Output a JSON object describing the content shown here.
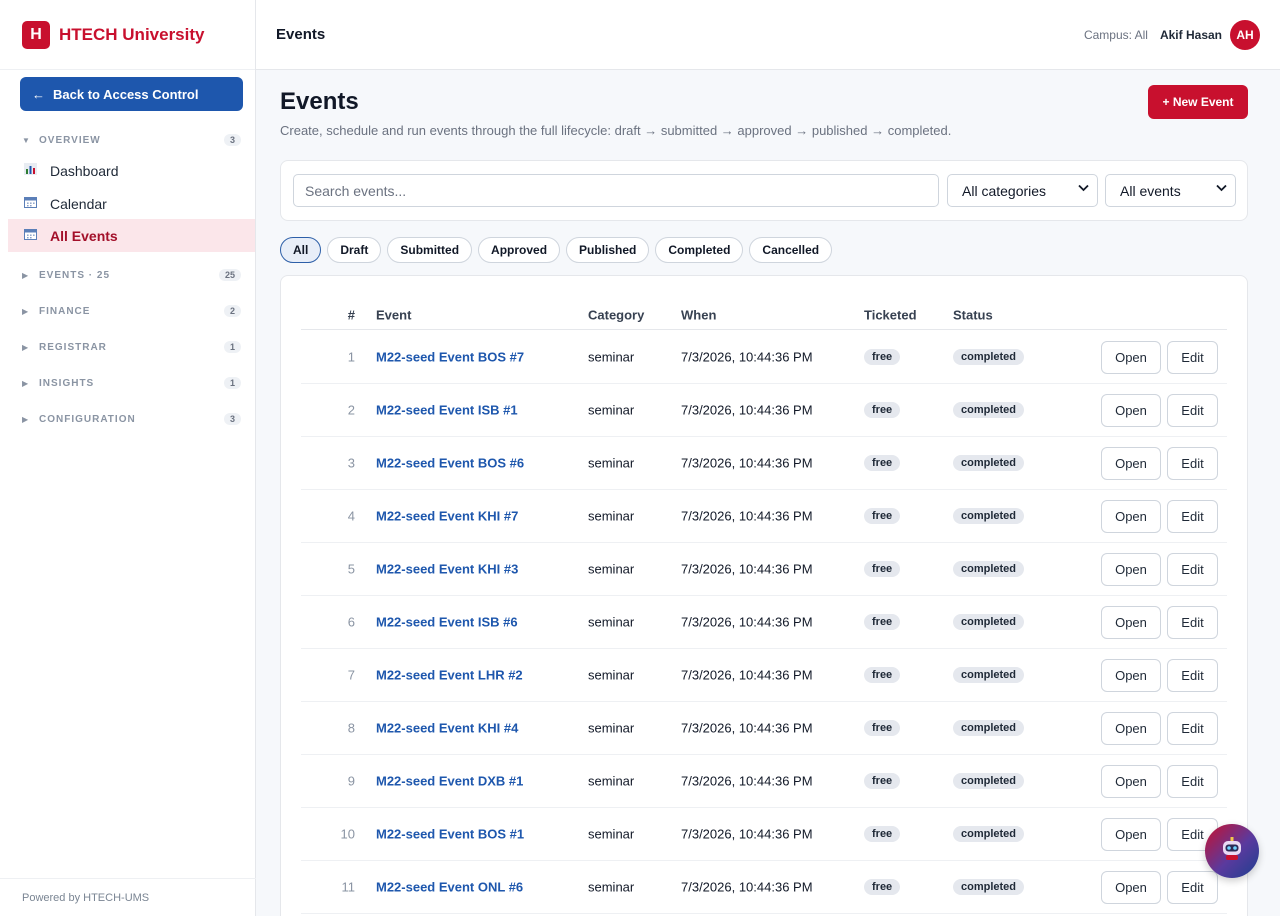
{
  "brand": {
    "logo": "H",
    "name": "HTECH University"
  },
  "sidebar": {
    "back_label": "Back to Access Control",
    "groups": [
      {
        "label": "OVERVIEW",
        "count": "3",
        "expanded": true
      },
      {
        "label": "EVENTS · 25",
        "count": "25",
        "expanded": false
      },
      {
        "label": "FINANCE",
        "count": "2",
        "expanded": false
      },
      {
        "label": "REGISTRAR",
        "count": "1",
        "expanded": false
      },
      {
        "label": "INSIGHTS",
        "count": "1",
        "expanded": false
      },
      {
        "label": "CONFIGURATION",
        "count": "3",
        "expanded": false
      }
    ],
    "items": [
      {
        "label": "Dashboard",
        "icon": "bar-chart-icon"
      },
      {
        "label": "Calendar",
        "icon": "calendar-icon"
      },
      {
        "label": "All Events",
        "icon": "calendar-icon",
        "active": true
      }
    ],
    "footer": "Powered by HTECH-UMS"
  },
  "topbar": {
    "title": "Events",
    "campus": "Campus: All",
    "user": "Akif Hasan",
    "avatar": "AH"
  },
  "page": {
    "title": "Events",
    "subtitle": "Create, schedule and run events through the full lifecycle: draft → submitted → approved → published → completed.",
    "new_button": "+ New Event"
  },
  "filters": {
    "search_placeholder": "Search events...",
    "category_value": "All categories",
    "scope_value": "All events"
  },
  "tabs": [
    "All",
    "Draft",
    "Submitted",
    "Approved",
    "Published",
    "Completed",
    "Cancelled"
  ],
  "table": {
    "headers": {
      "num": "#",
      "event": "Event",
      "category": "Category",
      "when": "When",
      "ticketed": "Ticketed",
      "status": "Status"
    },
    "open_label": "Open",
    "edit_label": "Edit",
    "rows": [
      {
        "num": "1",
        "event": "M22-seed Event BOS #7",
        "category": "seminar",
        "when": "7/3/2026, 10:44:36 PM",
        "ticketed": "free",
        "status": "completed"
      },
      {
        "num": "2",
        "event": "M22-seed Event ISB #1",
        "category": "seminar",
        "when": "7/3/2026, 10:44:36 PM",
        "ticketed": "free",
        "status": "completed"
      },
      {
        "num": "3",
        "event": "M22-seed Event BOS #6",
        "category": "seminar",
        "when": "7/3/2026, 10:44:36 PM",
        "ticketed": "free",
        "status": "completed"
      },
      {
        "num": "4",
        "event": "M22-seed Event KHI #7",
        "category": "seminar",
        "when": "7/3/2026, 10:44:36 PM",
        "ticketed": "free",
        "status": "completed"
      },
      {
        "num": "5",
        "event": "M22-seed Event KHI #3",
        "category": "seminar",
        "when": "7/3/2026, 10:44:36 PM",
        "ticketed": "free",
        "status": "completed"
      },
      {
        "num": "6",
        "event": "M22-seed Event ISB #6",
        "category": "seminar",
        "when": "7/3/2026, 10:44:36 PM",
        "ticketed": "free",
        "status": "completed"
      },
      {
        "num": "7",
        "event": "M22-seed Event LHR #2",
        "category": "seminar",
        "when": "7/3/2026, 10:44:36 PM",
        "ticketed": "free",
        "status": "completed"
      },
      {
        "num": "8",
        "event": "M22-seed Event KHI #4",
        "category": "seminar",
        "when": "7/3/2026, 10:44:36 PM",
        "ticketed": "free",
        "status": "completed"
      },
      {
        "num": "9",
        "event": "M22-seed Event DXB #1",
        "category": "seminar",
        "when": "7/3/2026, 10:44:36 PM",
        "ticketed": "free",
        "status": "completed"
      },
      {
        "num": "10",
        "event": "M22-seed Event BOS #1",
        "category": "seminar",
        "when": "7/3/2026, 10:44:36 PM",
        "ticketed": "free",
        "status": "completed"
      },
      {
        "num": "11",
        "event": "M22-seed Event ONL #6",
        "category": "seminar",
        "when": "7/3/2026, 10:44:36 PM",
        "ticketed": "free",
        "status": "completed"
      }
    ]
  },
  "colors": {
    "brand_red": "#c8102e",
    "primary_blue": "#1e57ad",
    "active_bg": "#fbe6ea"
  }
}
